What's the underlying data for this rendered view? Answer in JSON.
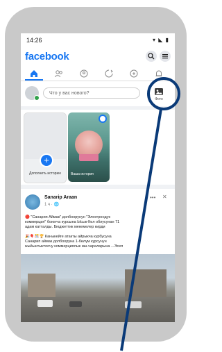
{
  "status_bar": {
    "time": "14:26",
    "icons": "▾ ◣ ▮"
  },
  "header": {
    "logo": "facebook"
  },
  "nav": {
    "tabs": [
      "home",
      "friends",
      "groups",
      "watch",
      "marketplace",
      "notifications"
    ],
    "active": "home"
  },
  "composer": {
    "placeholder": "Что у вас нового?",
    "photo_label": "Фото"
  },
  "stories": {
    "create_label": "Дополнить историю",
    "story_name": "Ваша история"
  },
  "post": {
    "author": "Sanarip Araan",
    "time": "1 ч · 🌐",
    "more": "•••",
    "close": "✕",
    "text1": "🔴 \"Санарип Аймак\" долбоорунун \"Электрондук\nкоммерция\" боюнча курсына Ысык-Көл облусунан 71\nадам катталды. Бюджеттик мекемелер кирди",
    "text2": "🎉🎈🎊🏆 Каныкейге атакты айрыкча курбусуна\nСанарип аймак долбооруна 1-бөлүм курсунун\nжыйынтыктоочу коммерциялык иш-чараларына ...Эсеп"
  },
  "colors": {
    "brand": "#1877f2",
    "annotation": "#0a3a78"
  }
}
